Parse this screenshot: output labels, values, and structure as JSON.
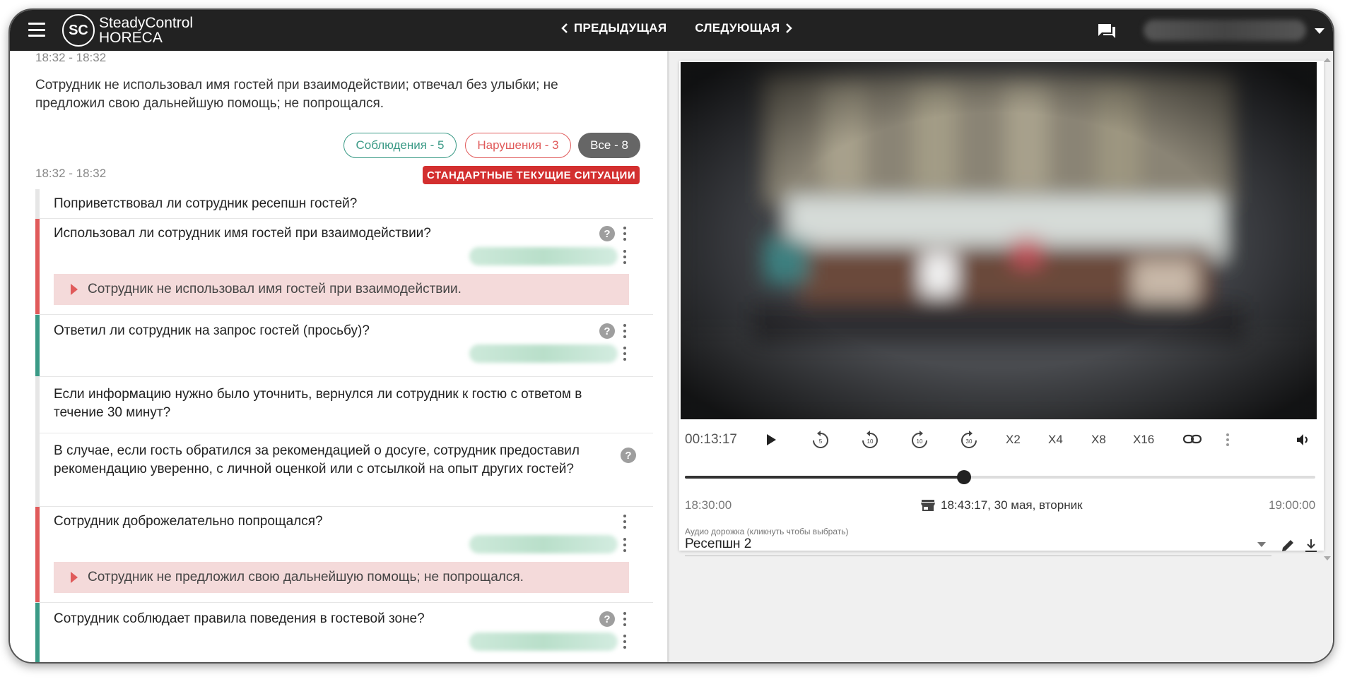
{
  "brand": {
    "logo": "SC",
    "name_line1": "SteadyControl",
    "name_line2": "HORECA"
  },
  "nav": {
    "prev": "ПРЕДЫДУЩАЯ",
    "next": "СЛЕДУЮЩАЯ"
  },
  "icons": {
    "menu": "hamburger-icon",
    "chat": "chat-icon",
    "user_menu": "caret-down-icon"
  },
  "summary": {
    "time": "18:32 - 18:32",
    "text": "Сотрудник не использовал имя гостей при взаимодействии; отвечал без улыбки; не предложил свою дальнейшую помощь; не попрощался."
  },
  "filters": {
    "compliance": "Соблюдения - 5",
    "violations": "Нарушения - 3",
    "all": "Все - 8"
  },
  "section": {
    "time": "18:32 - 18:32",
    "badge": "СТАНДАРТНЫЕ ТЕКУЩИЕ СИТУАЦИИ"
  },
  "questions": [
    {
      "text": "Поприветствовал ли сотрудник ресепшн гостей?",
      "status": "neutral"
    },
    {
      "text": "Использовал ли сотрудник имя гостей при взаимодействии?",
      "status": "violation",
      "comment": "Сотрудник не использовал имя гостей при взаимодействии."
    },
    {
      "text": "Ответил ли сотрудник на запрос гостей (просьбу)?",
      "status": "compliance"
    },
    {
      "text": "Если информацию нужно было уточнить, вернулся ли сотрудник к гостю с ответом в течение 30 минут?",
      "status": "neutral"
    },
    {
      "text": "В случае, если гость обратился за рекомендацией о досуге, сотрудник предоставил рекомендацию уверенно, с личной оценкой или с отсылкой на опыт других гостей?",
      "status": "neutral"
    },
    {
      "text": "Сотрудник доброжелательно попрощался?",
      "status": "violation",
      "comment": "Сотрудник не предложил свою дальнейшую помощь; не попрощался."
    },
    {
      "text": "Сотрудник соблюдает правила поведения в гостевой зоне?",
      "status": "compliance"
    }
  ],
  "player": {
    "current_time": "00:13:17",
    "speeds": [
      "X2",
      "X4",
      "X8",
      "X16"
    ],
    "skip_labels": [
      "5",
      "10",
      "10",
      "30"
    ],
    "progress": 0.443,
    "start": "18:30:00",
    "end": "19:00:00",
    "datetime": "18:43:17, 30 мая, вторник",
    "audio_label": "Аудио дорожка (кликнуть чтобы выбрать)",
    "audio_value": "Ресепшн 2"
  },
  "colors": {
    "violation": "#e05a5a",
    "compliance": "#3a9a86",
    "neutral": "#e0e0e0",
    "badge": "#d32f2f"
  }
}
